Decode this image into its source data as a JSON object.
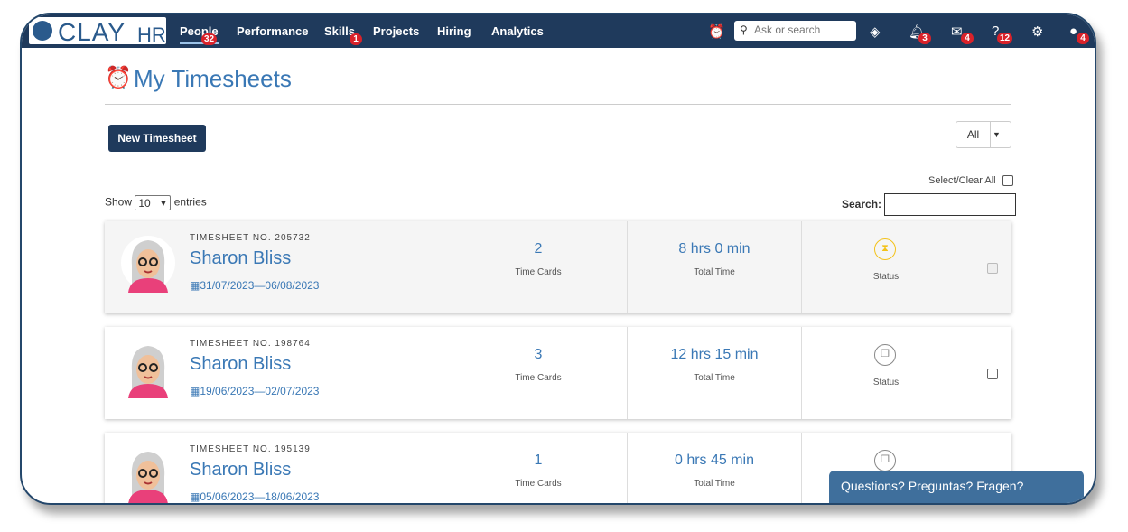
{
  "app": {
    "logo_text": "CLAY",
    "logo_suffix": "HR"
  },
  "nav": [
    {
      "label": "People",
      "badge": "32"
    },
    {
      "label": "Performance"
    },
    {
      "label": "Skills",
      "badge": "1"
    },
    {
      "label": "Projects"
    },
    {
      "label": "Hiring"
    },
    {
      "label": "Analytics"
    }
  ],
  "topbar": {
    "search_placeholder": "Ask or search",
    "notifications_badge": "3",
    "messages_badge": "4",
    "help_badge": "12",
    "profile_badge": "4"
  },
  "page": {
    "title": "My Timesheets",
    "new_button": "New Timesheet",
    "filter_value": "All",
    "select_clear_all": "Select/Clear All",
    "show_label": "Show",
    "entries_value": "10",
    "entries_label": "entries",
    "search_label": "Search:"
  },
  "timesheets": [
    {
      "number_label": "TIMESHEET NO. 205732",
      "name": "Sharon Bliss",
      "dates": "31/07/2023—06/08/2023",
      "time_cards": "2",
      "time_cards_label": "Time Cards",
      "total_time": "8 hrs 0 min",
      "total_time_label": "Total Time",
      "status_label": "Status",
      "status_icon": "hourglass-icon"
    },
    {
      "number_label": "TIMESHEET NO. 198764",
      "name": "Sharon Bliss",
      "dates": "19/06/2023—02/07/2023",
      "time_cards": "3",
      "time_cards_label": "Time Cards",
      "total_time": "12 hrs 15 min",
      "total_time_label": "Total Time",
      "status_label": "Status",
      "status_icon": "documents-icon"
    },
    {
      "number_label": "TIMESHEET NO. 195139",
      "name": "Sharon Bliss",
      "dates": "05/06/2023—18/06/2023",
      "time_cards": "1",
      "time_cards_label": "Time Cards",
      "total_time": "0 hrs 45 min",
      "total_time_label": "Total Time",
      "status_icon": "documents-icon"
    }
  ],
  "help_widget": {
    "label": "Questions? Preguntas? Fragen?"
  },
  "colors": {
    "topbar": "#1f3a5c",
    "accent": "#3a78b5",
    "badge": "#d9222a",
    "pending_status": "#f3c21a"
  }
}
